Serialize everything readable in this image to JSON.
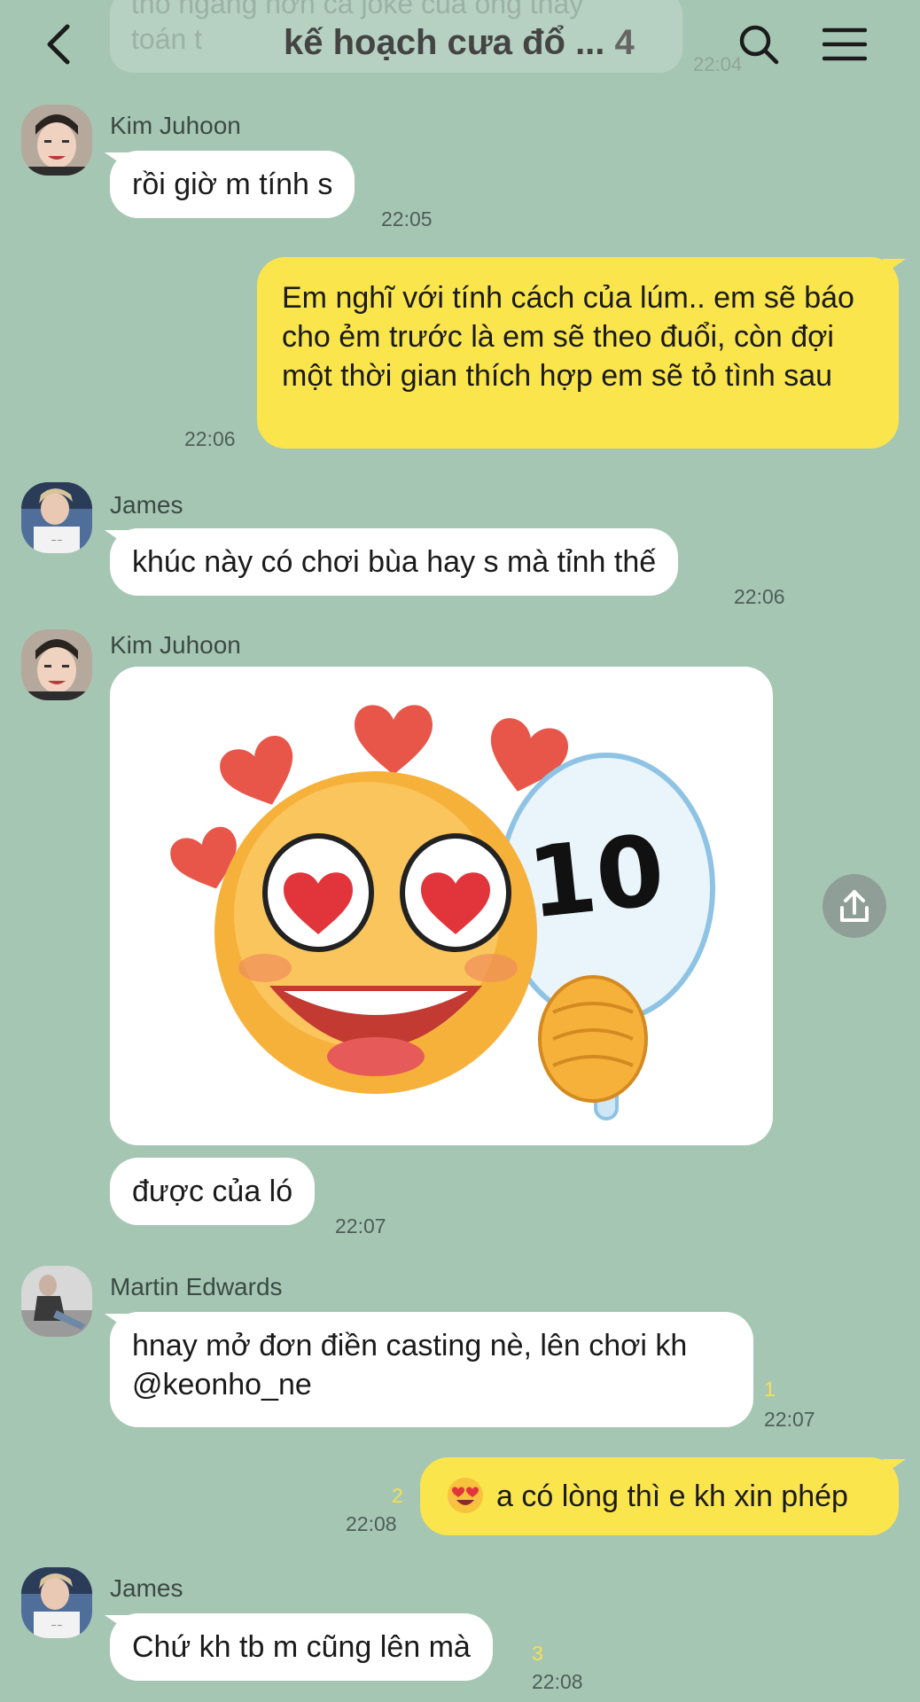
{
  "header": {
    "title": "kế hoạch cưa đổ ...",
    "member_count": "4"
  },
  "previous_message": {
    "text": "thô ngang hơn cả joke của ông thầy\ntoán t",
    "time": "22:04"
  },
  "messages": [
    {
      "sender": "Kim Juhoon",
      "text": "rồi giờ m tính s",
      "time": "22:05"
    },
    {
      "text": "Em nghĩ với tính cách của lúm.. em sẽ báo cho ẻm trước là em sẽ theo đuổi, còn đợi một thời gian thích hợp em sẽ tỏ tình sau",
      "time": "22:06"
    },
    {
      "sender": "James",
      "text": "khúc này có chơi bùa hay s mà tỉnh thế",
      "time": "22:06"
    },
    {
      "sender": "Kim Juhoon",
      "sticker_text": "10",
      "text": "được của ló",
      "time": "22:07"
    },
    {
      "sender": "Martin Edwards",
      "text": "hnay mở đơn điền casting nè, lên chơi kh @keonho_ne",
      "read_count": "1",
      "time": "22:07"
    },
    {
      "text": "a có lòng thì e kh xin phép",
      "read_count": "2",
      "time": "22:08"
    },
    {
      "sender": "James",
      "text": "Chứ kh tb m cũng lên mà",
      "read_count": "3",
      "time": "22:08"
    }
  ],
  "colors": {
    "background": "#a6c6b4",
    "incoming_bubble": "#ffffff",
    "outgoing_bubble": "#fae54d",
    "read_count": "#f6e052"
  },
  "icons": [
    "back-arrow-icon",
    "search-icon",
    "hamburger-menu-icon",
    "share-icon",
    "heart-eyes-emoji-icon"
  ]
}
